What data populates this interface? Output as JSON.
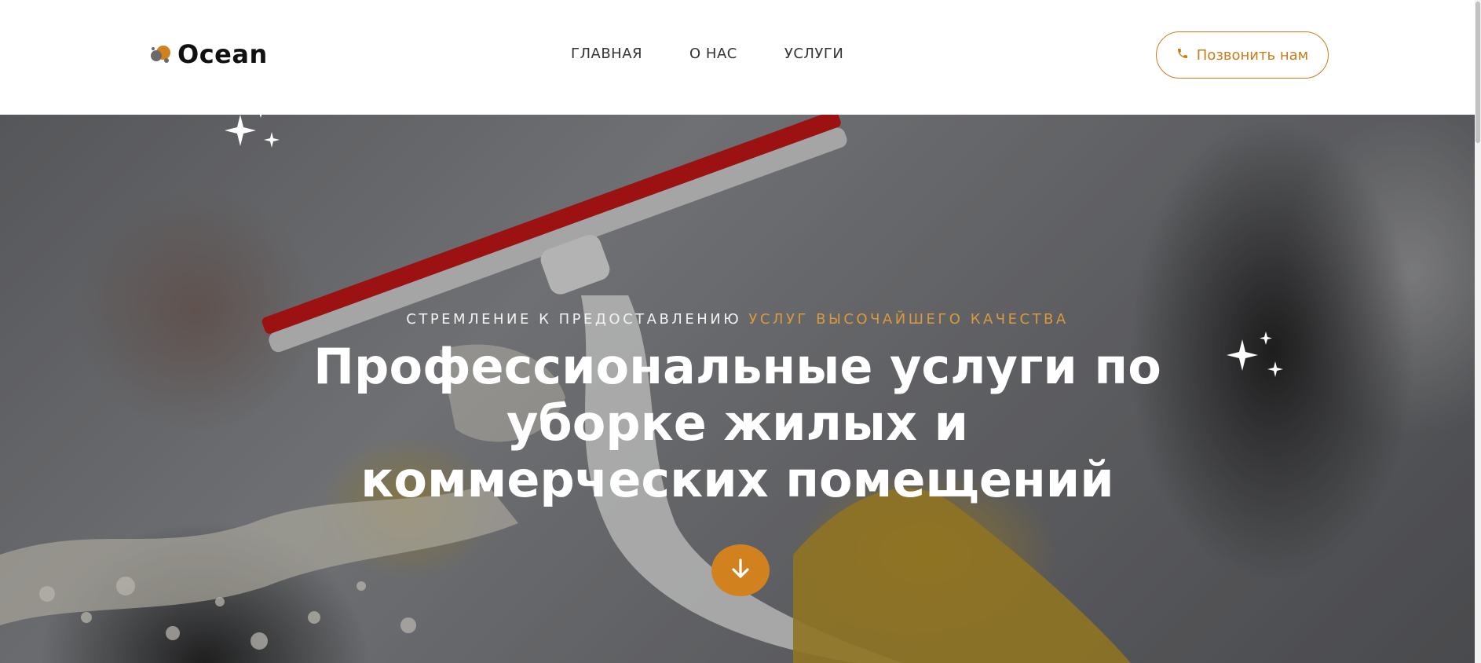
{
  "header": {
    "logo_text": "Ocean",
    "nav": [
      {
        "label": "ГЛАВНАЯ"
      },
      {
        "label": "О НАС"
      },
      {
        "label": "УСЛУГИ"
      }
    ],
    "call_button_label": "Позвонить нам",
    "call_icon": "phone-icon"
  },
  "hero": {
    "subtitle_white": "СТРЕМЛЕНИЕ К ПРЕДОСТАВЛЕНИЮ ",
    "subtitle_accent": "УСЛУГ ВЫСОЧАЙШЕГО КАЧЕСТВА",
    "headline": "Профессиональные услуги по уборке жилых и коммерческих помещений",
    "scroll_icon": "arrow-down-icon",
    "decor_icons": [
      "sparkle-icon",
      "sparkle-icon"
    ]
  },
  "colors": {
    "accent": "#d1821e",
    "accent_text": "#d99a3c",
    "text_dark": "#111111"
  }
}
